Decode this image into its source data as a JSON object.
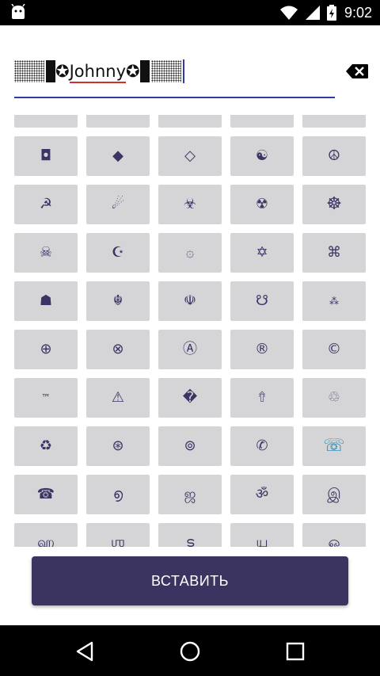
{
  "status_bar": {
    "time": "9:02",
    "icons": [
      "android-icon",
      "wifi-icon",
      "signal-icon",
      "battery-icon"
    ]
  },
  "input": {
    "typed_text": "Johnny",
    "star_glyph": "✪"
  },
  "grid": {
    "rows": [
      [
        "",
        "",
        "",
        "",
        ""
      ],
      [
        "◘",
        "◆",
        "◇",
        "☯",
        "☮"
      ],
      [
        "☭",
        "☄",
        "☣",
        "☢",
        "☸"
      ],
      [
        "☠",
        "☪",
        "۞",
        "✡",
        "⌘"
      ],
      [
        "☗",
        "☬",
        "☫",
        "☋",
        "⁂"
      ],
      [
        "⊕",
        "⊗",
        "Ⓐ",
        "®",
        "©"
      ],
      [
        "™",
        "⚠",
        "�",
        "⇮",
        "♲"
      ],
      [
        "♻",
        "⊛",
        "⊚",
        "✆",
        "☏"
      ],
      [
        "☎",
        "൭",
        "ஜ",
        "ॐ",
        "இ"
      ],
      [
        "ஹ",
        "ஶ",
        "ട",
        "ய",
        "ஒ"
      ]
    ]
  },
  "insert_button": {
    "label": "ВСТАВИТЬ"
  },
  "colors": {
    "accent": "#2f3aa5",
    "button": "#3b3461",
    "cell_bg": "#d5d5d7",
    "glyph": "#3a3564"
  }
}
